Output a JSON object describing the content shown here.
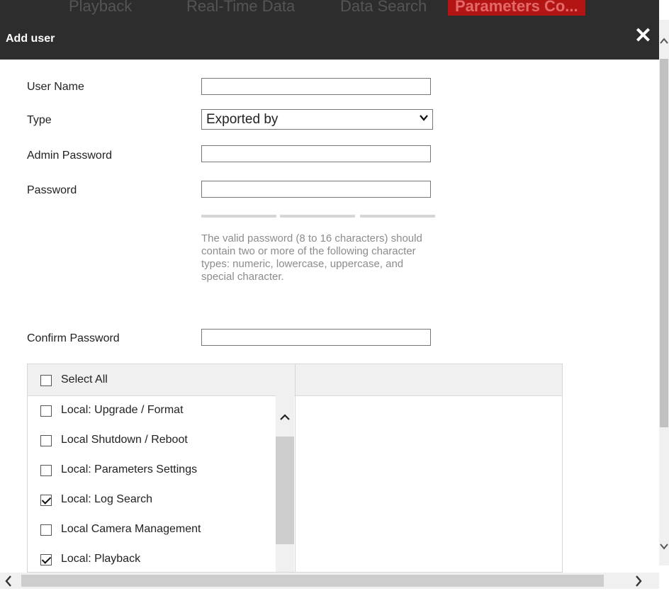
{
  "top_nav": {
    "items": [
      "Playback",
      "Real-Time Data",
      "Data Search"
    ],
    "active": "Parameters Co..."
  },
  "dialog": {
    "title": "Add user",
    "close_label": "✕"
  },
  "form": {
    "user_name_label": "User Name",
    "user_name_value": "",
    "type_label": "Type",
    "type_value": "Exported by",
    "admin_password_label": "Admin Password",
    "admin_password_value": "",
    "password_label": "Password",
    "password_value": "",
    "password_hint": "The valid password (8 to 16 characters) should contain two or more of the following character types: numeric, lowercase, uppercase, and special character.",
    "confirm_password_label": "Confirm Password",
    "confirm_password_value": ""
  },
  "permissions": {
    "select_all_label": "Select All",
    "select_all_checked": false,
    "items": [
      {
        "label": "Local: Upgrade / Format",
        "checked": false
      },
      {
        "label": "Local Shutdown / Reboot",
        "checked": false
      },
      {
        "label": "Local: Parameters Settings",
        "checked": false
      },
      {
        "label": "Local: Log Search",
        "checked": true
      },
      {
        "label": "Local Camera Management",
        "checked": false
      },
      {
        "label": "Local: Playback",
        "checked": true
      }
    ]
  },
  "colors": {
    "header_bg": "#2d2d2d",
    "active_tab": "#b31414",
    "hint_text": "#8c8c8c"
  },
  "icons": {
    "close": "close-icon",
    "dropdown": "chevron-down-icon",
    "scroll_up": "chevron-up-icon",
    "scroll_left": "chevron-left-icon",
    "scroll_right": "chevron-right-icon"
  }
}
